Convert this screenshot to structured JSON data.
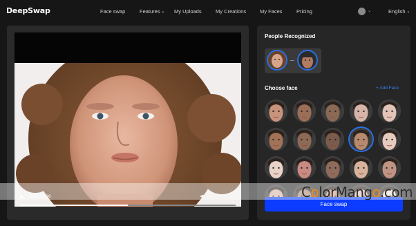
{
  "app": {
    "logo": "DeepSwap"
  },
  "nav": {
    "items": [
      {
        "label": "Face swap"
      },
      {
        "label": "Features"
      },
      {
        "label": "My Uploads"
      },
      {
        "label": "My Creations"
      },
      {
        "label": "My Faces"
      },
      {
        "label": "Pricing"
      }
    ],
    "language": "English"
  },
  "video": {
    "time": "0:18 / 0:36",
    "progress": 0.5
  },
  "right": {
    "people_title": "People Recognized",
    "choose_title": "Choose face",
    "add_face": "+ Add Face",
    "swap_label": "Face swap"
  },
  "faces": {
    "count": 25,
    "selected_index": 8,
    "skin_colors": [
      "#c8937a",
      "#9b6e58",
      "#8a6a55",
      "#d6b4a8",
      "#e2c3b8",
      "#a17257",
      "#8d6a55",
      "#7b5c4c",
      "#b7896e",
      "#e6cbbf",
      "#e9d2c7",
      "#c98a82",
      "#8f6b5b",
      "#d9b39c",
      "#bf9483",
      "#d8b4a4",
      "#a88774",
      "#c99a7e",
      "#dfc0b0",
      "#ece0d5",
      "#cba18d",
      "#b88f7b",
      "#9b7663",
      "#d6ae98",
      "#c4a08b"
    ]
  },
  "watermark": {
    "pre": "C",
    "o": "o",
    "mid": "lor",
    "mango_pre": "Mang",
    "mango_o": "o",
    "dotcom": ".com"
  },
  "colors": {
    "accent": "#0b3cff",
    "link": "#3c7cf0",
    "selection_ring": "#2a6fe8"
  }
}
